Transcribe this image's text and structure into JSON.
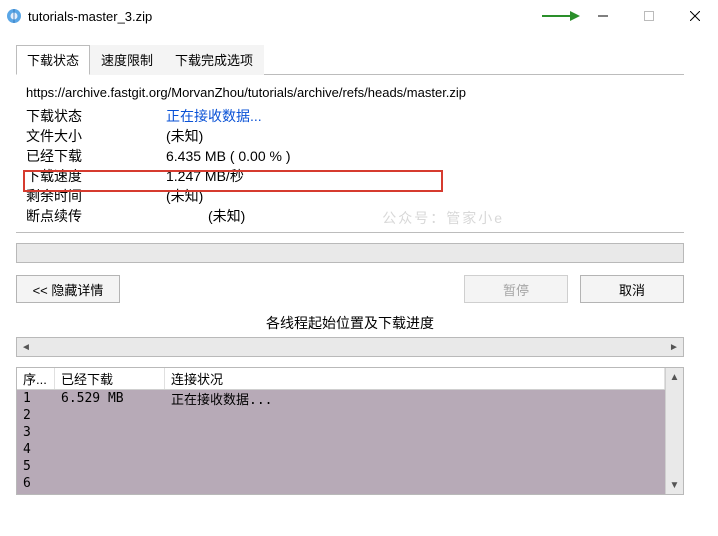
{
  "window": {
    "title": "tutorials-master_3.zip"
  },
  "tabs": {
    "download_status": "下载状态",
    "speed_limit": "速度限制",
    "on_complete": "下载完成选项"
  },
  "panel": {
    "url": "https://archive.fastgit.org/MorvanZhou/tutorials/archive/refs/heads/master.zip",
    "status_label": "下载状态",
    "status_value": "正在接收数据...",
    "filesize_label": "文件大小",
    "filesize_value": "(未知)",
    "downloaded_label": "已经下载",
    "downloaded_value": "6.435  MB  ( 0.00 % )",
    "speed_label": "下载速度",
    "speed_value": "1.247  MB/秒",
    "remaining_label": "剩余时间",
    "remaining_value": "(未知)",
    "resume_label": "断点续传",
    "resume_value": "(未知)",
    "watermark": "公众号：管家小e"
  },
  "buttons": {
    "hide_details": "<<  隐藏详情",
    "pause": "暂停",
    "cancel": "取消"
  },
  "threads": {
    "section_label": "各线程起始位置及下载进度",
    "headers": {
      "index": "序...",
      "downloaded": "已经下载",
      "status": "连接状况"
    },
    "rows": [
      {
        "idx": "1",
        "dl": "6.529  MB",
        "stat": "正在接收数据..."
      },
      {
        "idx": "2",
        "dl": "",
        "stat": ""
      },
      {
        "idx": "3",
        "dl": "",
        "stat": ""
      },
      {
        "idx": "4",
        "dl": "",
        "stat": ""
      },
      {
        "idx": "5",
        "dl": "",
        "stat": ""
      },
      {
        "idx": "6",
        "dl": "",
        "stat": ""
      }
    ]
  }
}
